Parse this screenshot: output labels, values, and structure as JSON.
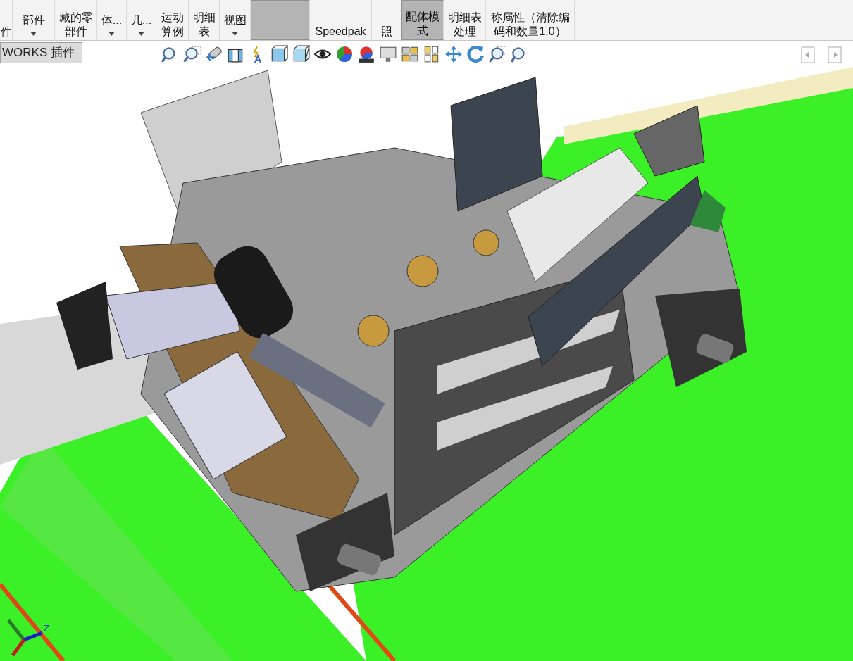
{
  "ribbon": {
    "buttons": [
      {
        "lines": [
          "件"
        ],
        "dropdown": false,
        "selected": false
      },
      {
        "lines": [
          "部件"
        ],
        "dropdown": true,
        "selected": false
      },
      {
        "lines": [
          "藏的零",
          "部件"
        ],
        "dropdown": false,
        "selected": false
      },
      {
        "lines": [
          "体..."
        ],
        "dropdown": true,
        "selected": false
      },
      {
        "lines": [
          "几..."
        ],
        "dropdown": true,
        "selected": false
      },
      {
        "lines": [
          "运动",
          "算例"
        ],
        "dropdown": false,
        "selected": false
      },
      {
        "lines": [
          "明细",
          "表"
        ],
        "dropdown": false,
        "selected": false
      },
      {
        "lines": [
          "视图"
        ],
        "dropdown": true,
        "selected": false
      },
      {
        "dropdown": false,
        "selected": true
      },
      {
        "lines": [
          "Speedpak"
        ],
        "dropdown": false,
        "selected": false
      },
      {
        "lines": [
          "照"
        ],
        "dropdown": false,
        "selected": false
      },
      {
        "lines": [
          "配体模",
          "式"
        ],
        "dropdown": false,
        "selected": true
      },
      {
        "lines": [
          "明细表",
          "处理"
        ],
        "dropdown": false,
        "selected": false
      },
      {
        "lines": [
          "称属性（清除编",
          "码和数量1.0）"
        ],
        "dropdown": false,
        "selected": false
      }
    ]
  },
  "tabs": [
    {
      "label": "WORKS 插件",
      "selected": true
    }
  ],
  "triad": {
    "axis_label": "Z"
  }
}
